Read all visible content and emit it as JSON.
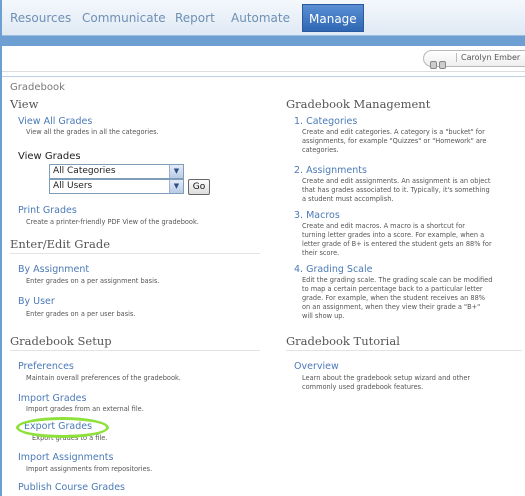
{
  "nav": {
    "tabs": [
      "Resources",
      "Communicate",
      "Report",
      "Automate",
      "Manage"
    ]
  },
  "user": {
    "name": "Carolyn Ember"
  },
  "breadcrumb": "Gradebook",
  "view": {
    "heading": "View",
    "view_all": {
      "label": "View All Grades",
      "desc": "View all the grades in all the categories."
    },
    "view_grades_label": "View Grades",
    "category_select": "All Categories",
    "user_select": "All Users",
    "go_label": "Go",
    "print": {
      "label": "Print Grades",
      "desc": "Create a printer-friendly PDF View of the gradebook."
    }
  },
  "enter_edit": {
    "heading": "Enter/Edit Grade",
    "by_assignment": {
      "label": "By Assignment",
      "desc": "Enter grades on a per assignment basis."
    },
    "by_user": {
      "label": "By User",
      "desc": "Enter grades on a per user basis."
    }
  },
  "setup": {
    "heading": "Gradebook Setup",
    "preferences": {
      "label": "Preferences",
      "desc": "Maintain overall preferences of the gradebook."
    },
    "import_grades": {
      "label": "Import Grades",
      "desc": "Import grades from an external file."
    },
    "export_grades": {
      "label": "Export Grades",
      "desc": "Export grades to a file."
    },
    "import_assignments": {
      "label": "Import Assignments",
      "desc": "Import assignments from repositories."
    },
    "publish": {
      "label": "Publish Course Grades"
    }
  },
  "management": {
    "heading": "Gradebook Management",
    "categories": {
      "label": "1. Categories",
      "desc": [
        "Create and edit categories. A category is a \"bucket\" for",
        "assignments, for example \"Quizzes\" or \"Homework\" are",
        "categories."
      ]
    },
    "assignments": {
      "label": "2. Assignments",
      "desc": [
        "Create and edit assignments. An assignment is an object",
        "that has grades associated to it. Typically, it's something",
        "a student must accomplish."
      ]
    },
    "macros": {
      "label": "3. Macros",
      "desc": [
        "Create and edit macros. A macro is a shortcut for",
        "turning letter grades into a score. For example, when a",
        "letter grade of B+ is entered the student gets an 88% for",
        "their score."
      ]
    },
    "scale": {
      "label": "4. Grading Scale",
      "desc": [
        "Edit the grading scale. The grading scale can be modified",
        "to map a certain percentage back to a particular letter",
        "grade. For example, when the student receives an 88%",
        "on an assignment, when they view their grade a \"B+\"",
        "will show up."
      ]
    }
  },
  "tutorial": {
    "heading": "Gradebook Tutorial",
    "overview": {
      "label": "Overview",
      "desc": [
        "Learn about the gradebook setup wizard and other",
        "commonly used gradebook features."
      ]
    }
  },
  "colors": {
    "link": "#4a7ab7",
    "accent": "#6d9fd3",
    "highlight_circle": "#8ee13a"
  }
}
